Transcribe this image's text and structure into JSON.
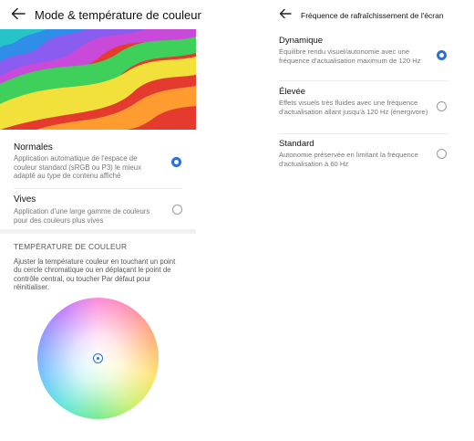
{
  "color_mode": {
    "title": "Mode & température de couleur",
    "options": [
      {
        "title": "Normales",
        "description": "Application automatique de l'espace de couleur standard (sRGB ou P3) le mieux adapté au type de contenu affiché",
        "selected": true
      },
      {
        "title": "Vives",
        "description": "Application d'une large gamme de couleurs pour des couleurs plus vives",
        "selected": false
      }
    ],
    "temperature": {
      "title": "TEMPÉRATURE DE COULEUR",
      "description": "Ajuster la température couleur en touchant un point du cercle chromatique ou en déplaçant le point de contrôle central, ou toucher Par défaut pour réinitialiser."
    }
  },
  "refresh_rate": {
    "title": "Fréquence de rafraîchissement de l'écran",
    "options": [
      {
        "title": "Dynamique",
        "description": "Équilibre rendu visuel/autonomie avec une fréquence d'actualisation maximum de 120 Hz",
        "selected": true
      },
      {
        "title": "Élevée",
        "description": "Effets visuels très fluides avec une fréquence d'actualisation allant jusqu'à 120 Hz (énergivore)",
        "selected": false
      },
      {
        "title": "Standard",
        "description": "Autonomie préservée en limitant la fréquence d'actualisation à 60 Hz",
        "selected": false
      }
    ]
  },
  "colors": {
    "accent": "#2a6fe0",
    "text_primary": "#111111",
    "text_secondary": "#777777"
  },
  "icons": {
    "back": "back-arrow-icon",
    "radio_on": "radio-selected-icon",
    "radio_off": "radio-unselected-icon",
    "wheel_handle": "control-point-icon"
  }
}
